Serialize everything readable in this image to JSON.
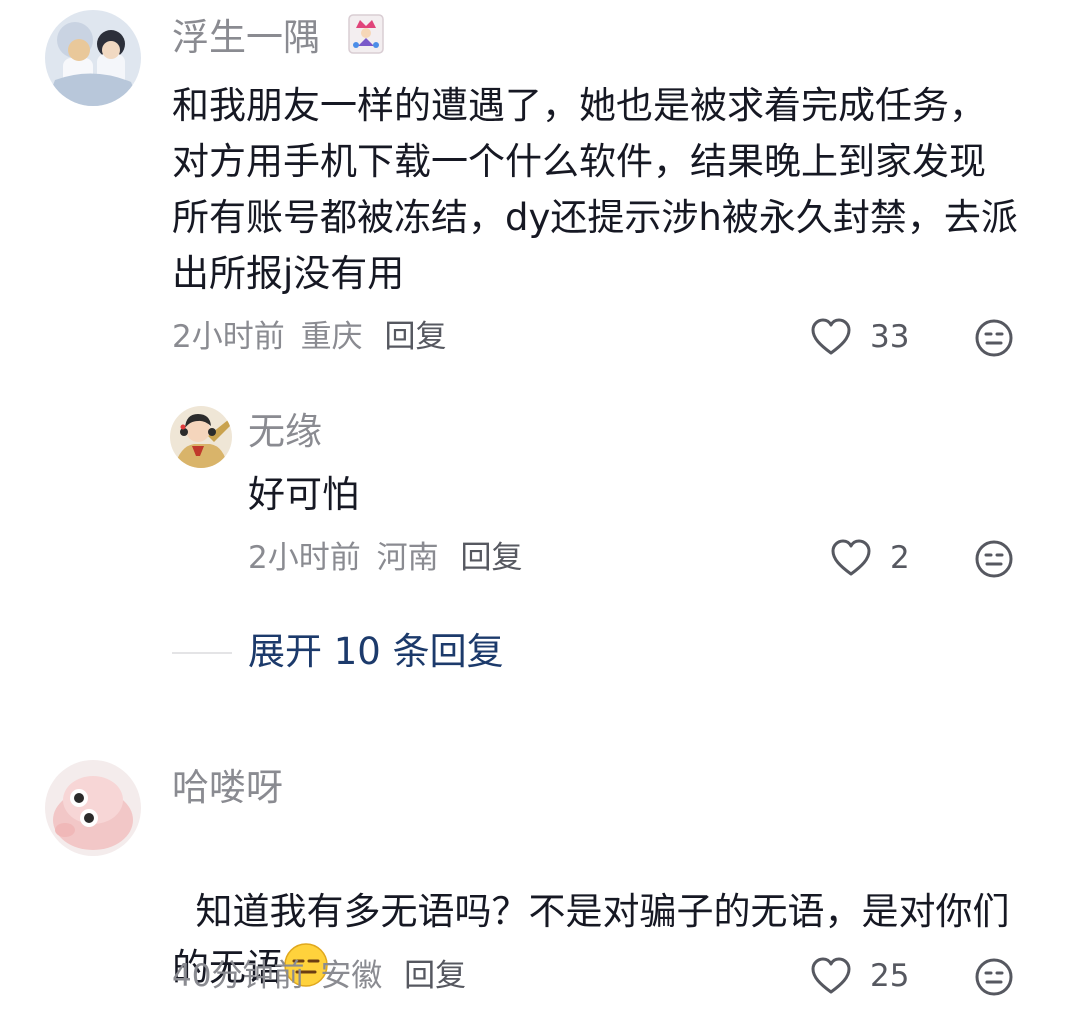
{
  "comments": [
    {
      "username": "浮生一隅",
      "badge_icon": "joker-card-icon",
      "content": "和我朋友一样的遭遇了，她也是被求着完成任务，对方用手机下载一个什么软件，结果晚上到家发现所有账号都被冻结，dy还提示涉h被永久封禁，去派出所报j没有用",
      "time": "2小时前",
      "location": "重庆",
      "reply_label": "回复",
      "likes": "33"
    },
    {
      "username": "无缘",
      "content": "好可怕",
      "time": "2小时前",
      "location": "河南",
      "reply_label": "回复",
      "likes": "2"
    },
    {
      "username": "哈喽呀",
      "content": "知道我有多无语吗？不是对骗子的无语，是对你们的无语",
      "emoji": "expressionless-face-emoji",
      "time": "40分钟前",
      "location": "安徽",
      "reply_label": "回复",
      "likes": "25"
    }
  ],
  "expand_label": "展开 10 条回复",
  "icons": {
    "like": "heart-outline-icon",
    "dislike": "meh-face-icon"
  },
  "colors": {
    "text": "#161823",
    "secondary": "#8a8b91",
    "expand": "#1c3a6b",
    "emoji_yellow": "#ffd23c"
  }
}
